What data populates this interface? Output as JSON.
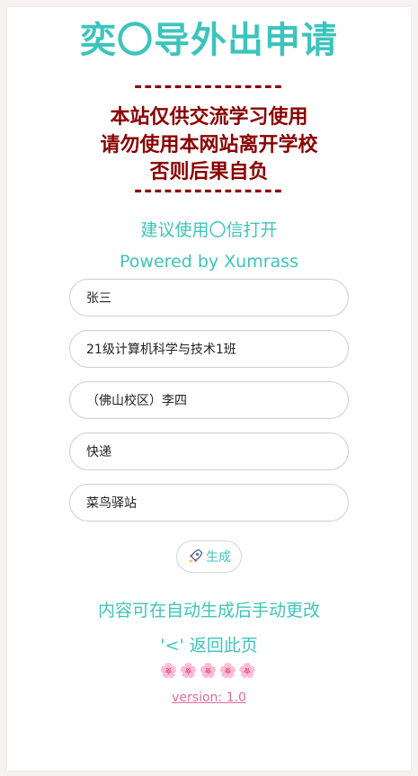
{
  "header": {
    "title": "奕〇导外出申请"
  },
  "warning": {
    "dashes_top": "---------------",
    "lines": [
      "本站仅供交流学习使用",
      "请勿使用本网站离开学校",
      "否则后果自负"
    ],
    "dashes_bottom": "---------------"
  },
  "hints": {
    "open_tip": "建议使用〇信打开",
    "powered_by": "Powered by Xumrass"
  },
  "form": {
    "fields": [
      {
        "value": "张三"
      },
      {
        "value": "21级计算机科学与技术1班"
      },
      {
        "value": "（佛山校区）李四"
      },
      {
        "value": "快递"
      },
      {
        "value": "菜鸟驿站"
      }
    ]
  },
  "generate_button": {
    "icon": "rocket-icon",
    "label": "生成"
  },
  "footer": {
    "note": "内容可在自动生成后手动更改",
    "back": "'<' 返回此页",
    "flowers": "🌸🌸🌸🌸🌸",
    "version": "version: 1.0"
  },
  "colors": {
    "accent": "#3cc4bc",
    "warning": "#8b0000",
    "link": "#e06a98"
  }
}
